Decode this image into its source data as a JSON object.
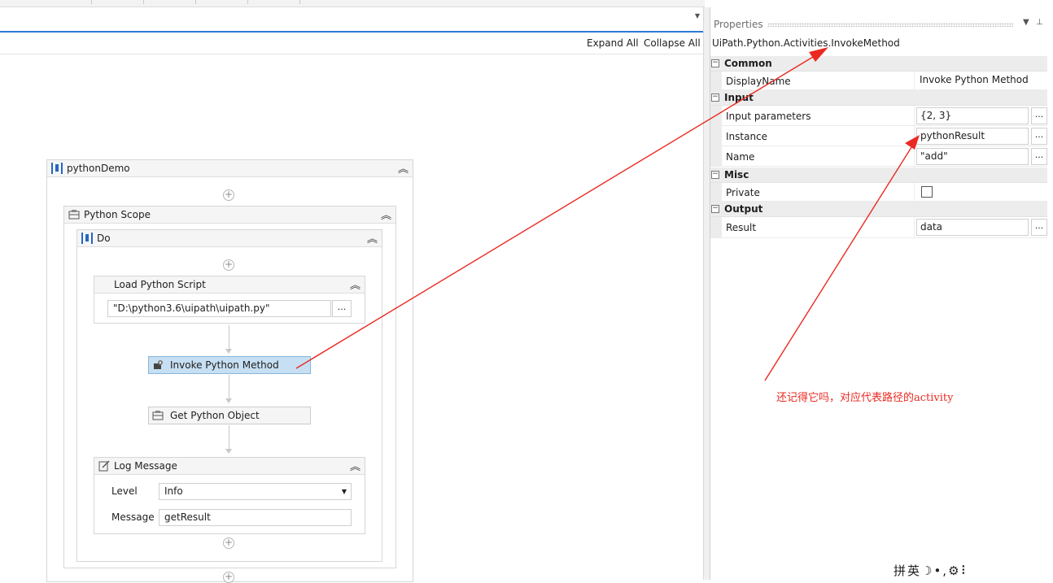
{
  "toolbar": {
    "expand_all": "Expand All",
    "collapse_all": "Collapse All"
  },
  "workflow": {
    "root": {
      "title": "pythonDemo"
    },
    "scope": {
      "title": "Python Scope"
    },
    "do": {
      "title": "Do"
    },
    "load_script": {
      "title": "Load Python Script",
      "path": "\"D:\\python3.6\\uipath\\uipath.py\""
    },
    "invoke_method": {
      "title": "Invoke Python Method"
    },
    "get_object": {
      "title": "Get Python Object"
    },
    "log_message": {
      "title": "Log Message",
      "level_label": "Level",
      "level_value": "Info",
      "message_label": "Message",
      "message_value": "getResult"
    },
    "ellipsis": "..."
  },
  "properties": {
    "title": "Properties",
    "type_name": "UiPath.Python.Activities.InvokeMethod",
    "categories": {
      "common": "Common",
      "input": "Input",
      "misc": "Misc",
      "output": "Output"
    },
    "rows": {
      "display_name": {
        "name": "DisplayName",
        "value": "Invoke Python Method"
      },
      "input_parameters": {
        "name": "Input parameters",
        "value": "{2, 3}"
      },
      "instance": {
        "name": "Instance",
        "value": "pythonResult"
      },
      "method_name": {
        "name": "Name",
        "value": "\"add\""
      },
      "private": {
        "name": "Private",
        "checked": false
      },
      "result": {
        "name": "Result",
        "value": "data"
      }
    },
    "ellipsis": "..."
  },
  "annotation": {
    "note": "还记得它吗，对应代表路径的activity",
    "color": "#ea2a22"
  },
  "ime": {
    "text": "拼英☽•,⚙⠇"
  }
}
